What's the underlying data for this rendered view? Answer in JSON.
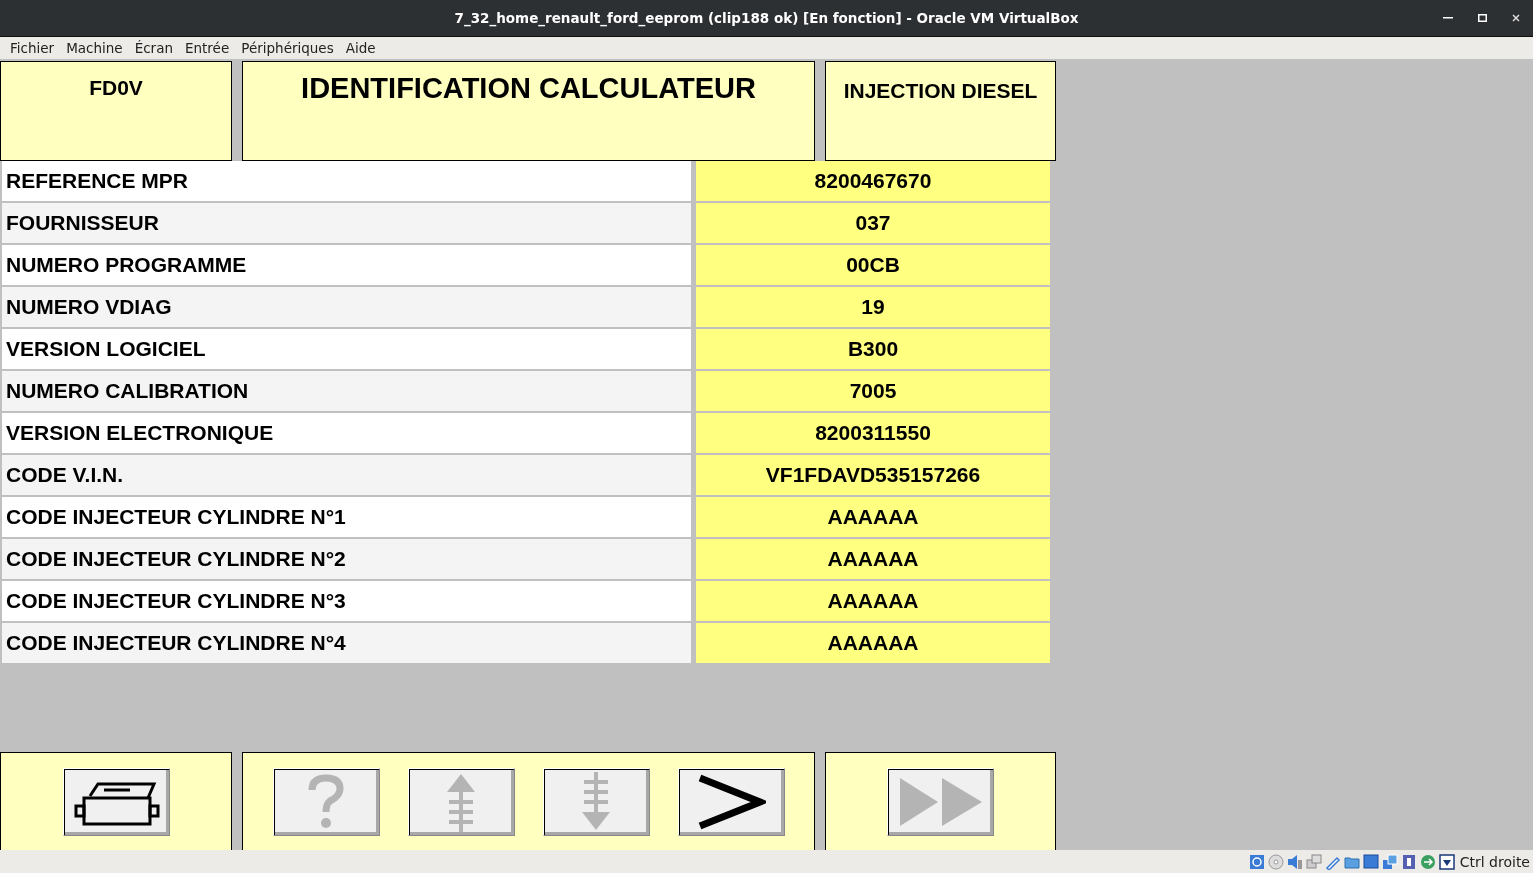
{
  "window": {
    "title": "7_32_home_renault_ford_eeprom (clip188 ok) [En fonction] - Oracle VM VirtualBox"
  },
  "menu": [
    "Fichier",
    "Machine",
    "Écran",
    "Entrée",
    "Périphériques",
    "Aide"
  ],
  "header": {
    "code": "FD0V",
    "title": "IDENTIFICATION CALCULATEUR",
    "system": "INJECTION DIESEL"
  },
  "rows": [
    {
      "label": "REFERENCE MPR",
      "value": "8200467670"
    },
    {
      "label": "FOURNISSEUR",
      "value": "037"
    },
    {
      "label": "NUMERO PROGRAMME",
      "value": "00CB"
    },
    {
      "label": "NUMERO VDIAG",
      "value": "19"
    },
    {
      "label": "VERSION LOGICIEL",
      "value": "B300"
    },
    {
      "label": "NUMERO CALIBRATION",
      "value": "7005"
    },
    {
      "label": "VERSION ELECTRONIQUE",
      "value": "8200311550"
    },
    {
      "label": "CODE V.I.N.",
      "value": "VF1FDAVD535157266"
    },
    {
      "label": "CODE INJECTEUR CYLINDRE N°1",
      "value": "AAAAAA"
    },
    {
      "label": "CODE INJECTEUR CYLINDRE N°2",
      "value": "AAAAAA"
    },
    {
      "label": "CODE INJECTEUR CYLINDRE N°3",
      "value": "AAAAAA"
    },
    {
      "label": "CODE INJECTEUR CYLINDRE N°4",
      "value": "AAAAAA"
    }
  ],
  "toolbar": [
    [
      {
        "kind": "print",
        "disabled": false
      }
    ],
    [
      {
        "kind": "help",
        "disabled": true
      },
      {
        "kind": "up",
        "disabled": true
      },
      {
        "kind": "down",
        "disabled": true
      },
      {
        "kind": "next",
        "disabled": false
      }
    ],
    [
      {
        "kind": "fast",
        "disabled": true
      }
    ]
  ],
  "status_bar": {
    "host_key": "Ctrl droite"
  }
}
